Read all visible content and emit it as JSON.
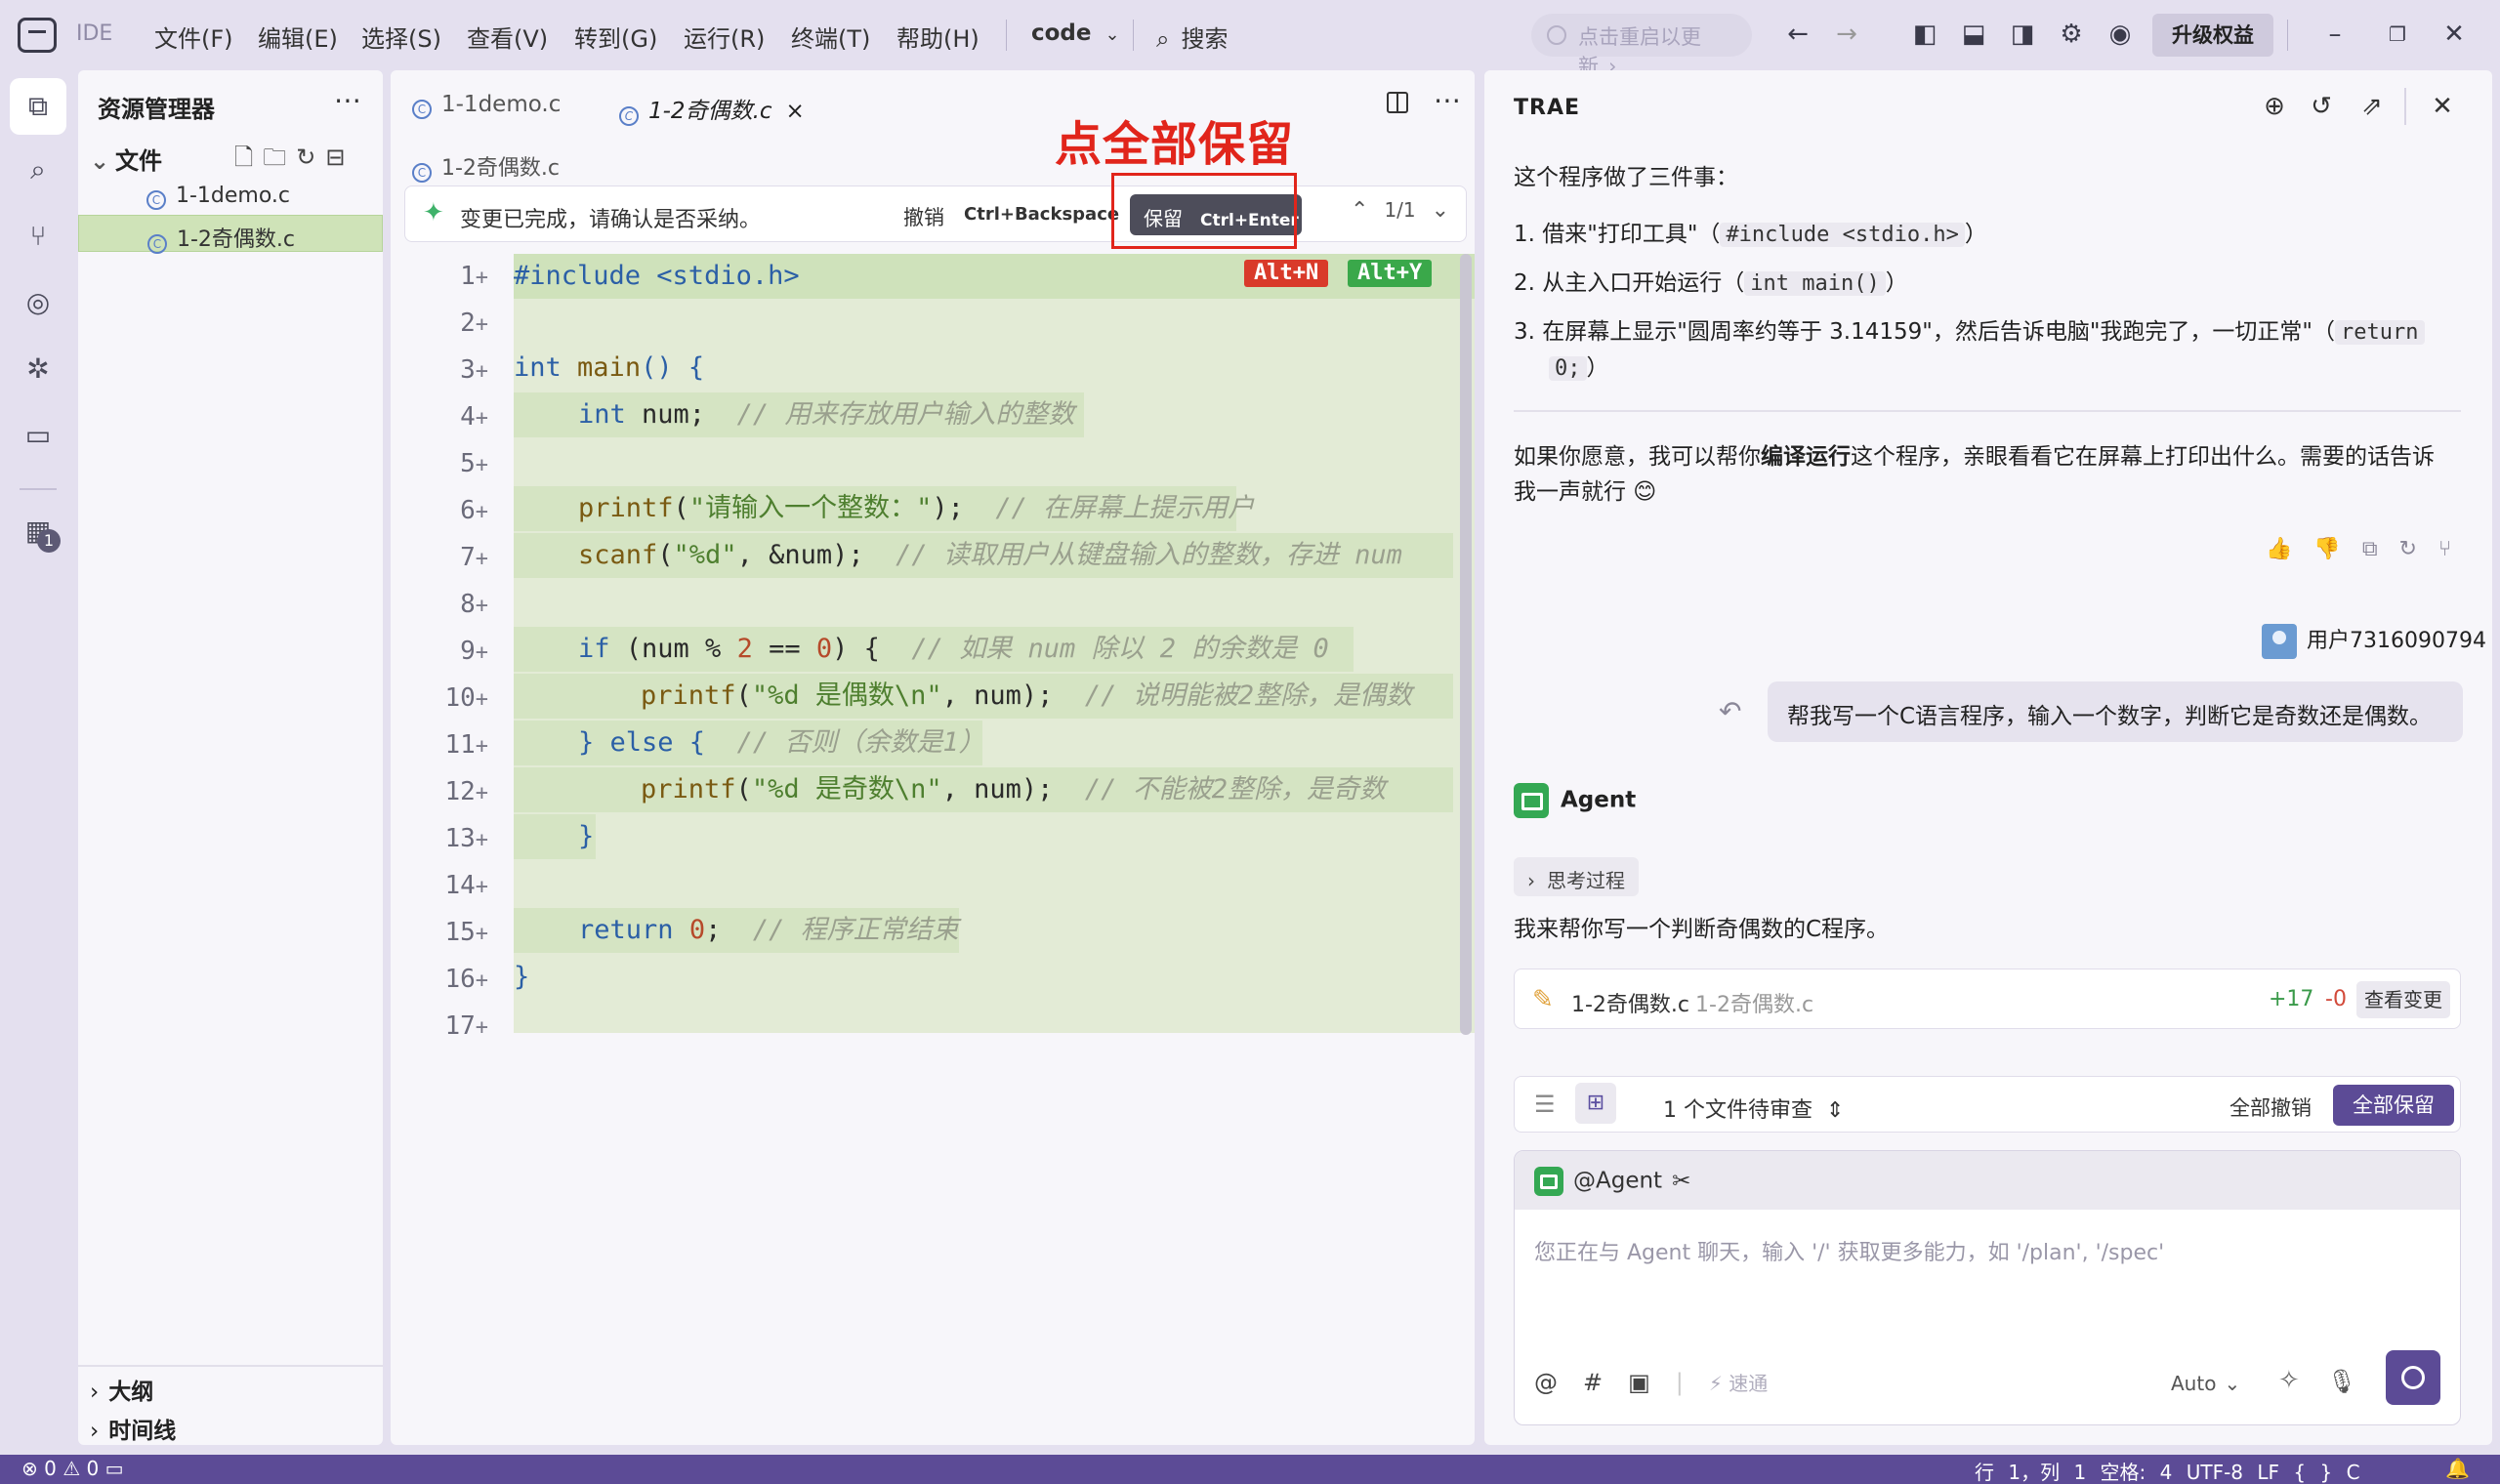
{
  "titlebar": {
    "product": "IDE",
    "menus": [
      "文件(F)",
      "编辑(E)",
      "选择(S)",
      "查看(V)",
      "转到(G)",
      "运行(R)",
      "终端(T)",
      "帮助(H)"
    ],
    "workspace": "code",
    "search": "搜索",
    "restart_update": "点击重启以更新",
    "upgrade": "升级权益"
  },
  "explorer": {
    "title": "资源管理器",
    "folder": "文件",
    "files": [
      "1-1demo.c",
      "1-2奇偶数.c"
    ],
    "selected_file": "1-2奇偶数.c",
    "outline": "大纲",
    "timeline": "时间线"
  },
  "editor": {
    "tabs": [
      {
        "label": "1-1demo.c",
        "active": false
      },
      {
        "label": "1-2奇偶数.c",
        "active": true
      }
    ],
    "breadcrumb": "1-2奇偶数.c",
    "review": {
      "message": "变更已完成，请确认是否采纳。",
      "undo": "撤销",
      "undo_key": "Ctrl+Backspace",
      "keep": "保留",
      "keep_key": "Ctrl+Enter",
      "counter": "1/1"
    },
    "annotation": "点全部保留",
    "tags": {
      "reject": "Alt+N",
      "accept": "Alt+Y",
      "reject_color": "#d93a2a",
      "accept_color": "#3aa84a"
    },
    "line_numbers": [
      "1",
      "2",
      "3",
      "4",
      "5",
      "6",
      "7",
      "8",
      "9",
      "10",
      "11",
      "12",
      "13",
      "14",
      "15",
      "16",
      "17"
    ],
    "code": {
      "l1": "#include <stdio.h>",
      "l3_kw": "int",
      "l3_fn": "main",
      "l3_rest": "() {",
      "l4_kw": "int",
      "l4_rest": " num;",
      "l4_cm": "// 用来存放用户输入的整数",
      "l6_fn": "printf",
      "l6_a": "(",
      "l6_str": "\"请输入一个整数：\"",
      "l6_b": ");",
      "l6_cm": "// 在屏幕上提示用户",
      "l7_fn": "scanf",
      "l7_a": "(",
      "l7_str": "\"%d\"",
      "l7_b": ", &num);",
      "l7_cm": "// 读取用户从键盘输入的整数，存进 num",
      "l9_kw": "if",
      "l9_a": " (num % ",
      "l9_n1": "2",
      "l9_b": " == ",
      "l9_n2": "0",
      "l9_c": ") {",
      "l9_cm": "// 如果 num 除以 2 的余数是 0",
      "l10_fn": "printf",
      "l10_a": "(",
      "l10_str": "\"%d 是偶数\\n\"",
      "l10_b": ", num);",
      "l10_cm": "// 说明能被2整除，是偶数",
      "l11_a": "} ",
      "l11_kw": "else",
      "l11_b": " {",
      "l11_cm": "// 否则（余数是1）",
      "l12_fn": "printf",
      "l12_a": "(",
      "l12_str": "\"%d 是奇数\\n\"",
      "l12_b": ", num);",
      "l12_cm": "// 不能被2整除，是奇数",
      "l13": "}",
      "l15_kw": "return",
      "l15_n": "0",
      "l15_b": ";",
      "l15_cm": "// 程序正常结束",
      "l16": "}"
    }
  },
  "chat": {
    "title": "TRAE",
    "intro": "这个程序做了三件事：",
    "steps": [
      {
        "n": "1.",
        "a": "借来\"打印工具\"（",
        "code": "#include <stdio.h>",
        "b": "）"
      },
      {
        "n": "2.",
        "a": "从主入口开始运行（",
        "code": "int main()",
        "b": "）"
      },
      {
        "n": "3.",
        "a": "在屏幕上显示\"圆周率约等于 3.14159\"，然后告诉电脑\"我跑完了，一切正常\"（",
        "code": "return",
        "code2": "0;",
        "b": "）"
      }
    ],
    "followup_a": "如果你愿意，我可以帮你",
    "followup_bold": "编译运行",
    "followup_b": "这个程序，亲眼看看它在屏幕上打印出什么。需要的话告诉",
    "followup_c": "我一声就行 😊",
    "user_name": "用户7316090794",
    "user_message": "帮我写一个C语言程序，输入一个数字，判断它是奇数还是偶数。",
    "agent_name": "Agent",
    "thinking": "思考过程",
    "agent_reply": "我来帮你写一个判断奇偶数的C程序。",
    "file_card": {
      "name": "1-2奇偶数.c",
      "path": "1-2奇偶数.c",
      "added": "+17",
      "removed": "-0",
      "view": "查看变更"
    },
    "review_panel": {
      "pending": "1 个文件待审查",
      "undo_all": "全部撤销",
      "keep_all": "全部保留"
    },
    "input": {
      "agent_label": "@Agent",
      "placeholder": "您正在与 Agent 聊天，输入 '/' 获取更多能力，如 '/plan', '/spec'",
      "speed": "速通",
      "mode": "Auto"
    }
  },
  "statusbar": {
    "errors": "0",
    "warnings": "0",
    "position": "行 1，列 1",
    "spaces": "空格: 4",
    "encoding": "UTF-8",
    "eol": "LF",
    "language": "C"
  },
  "colors": {
    "accent": "#5c4b96",
    "annotation": "#e1251b",
    "diff_added": "#e3ebd6"
  }
}
